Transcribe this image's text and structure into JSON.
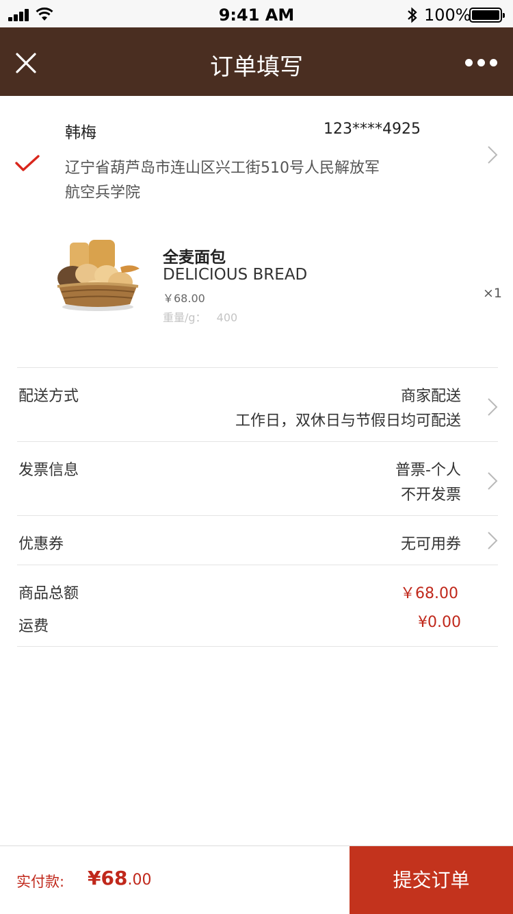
{
  "status_bar": {
    "time": "9:41 AM",
    "battery": "100%"
  },
  "nav": {
    "title": "订单填写",
    "close_icon": "close-icon",
    "more_icon": "more-icon"
  },
  "address": {
    "name": "韩梅",
    "phone": "123****4925",
    "line1": "辽宁省葫芦岛市连山区兴工街510号人民解放军",
    "line2": "航空兵学院"
  },
  "product": {
    "name": "全麦面包",
    "name_en": "DELICIOUS BREAD",
    "price": "￥68.00",
    "weight_label": "重量/g：",
    "weight": "400",
    "quantity": "×1"
  },
  "delivery": {
    "label": "配送方式",
    "value": "商家配送",
    "note": "工作日，双休日与节假日均可配送"
  },
  "invoice": {
    "label": "发票信息",
    "value": "普票-个人",
    "note": "不开发票"
  },
  "coupon": {
    "label": "优惠券",
    "value": "无可用券"
  },
  "summary": {
    "subtotal_label": "商品总额",
    "subtotal": "￥68.00",
    "shipping_label": "运费",
    "shipping": "¥0.00"
  },
  "footer": {
    "pay_label": "实付款:",
    "pay_amount_main": "¥68",
    "pay_amount_cents": ".00",
    "submit_label": "提交订单"
  },
  "colors": {
    "nav": "#4a2e21",
    "accent_red": "#c0281b",
    "submit_bg": "#c3331d"
  }
}
